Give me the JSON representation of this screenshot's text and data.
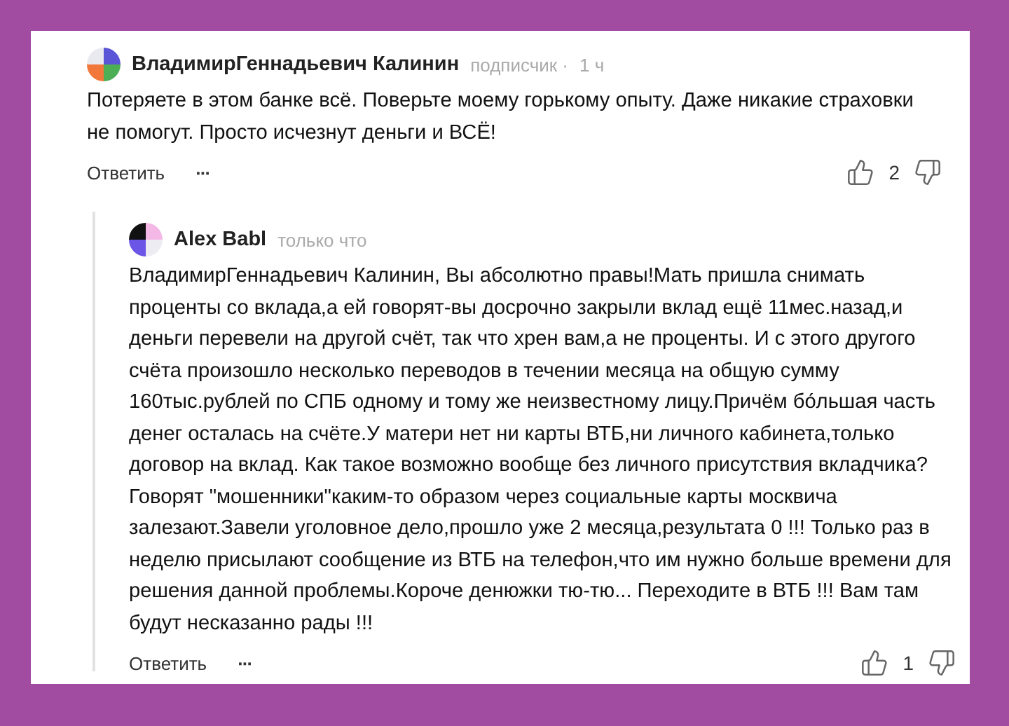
{
  "comments": [
    {
      "author": "ВладимирГеннадьевич Калинин",
      "badge": "подписчик ·",
      "time": "1 ч",
      "text": "Потеряете в этом банке всё. Поверьте моему горькому опыту. Даже никакие страховки не помогут. Просто исчезнут деньги и ВСЁ!",
      "reply_label": "Ответить",
      "more": "···",
      "likes": "2",
      "replies": [
        {
          "author": "Alex Babl",
          "time": "только что",
          "text": "ВладимирГеннадьевич Калинин, Вы абсолютно правы!Мать пришла снимать проценты со вклада,а ей говорят-вы досрочно закрыли вклад ещё 11мес.назад,и деньги перевели на другой счёт, так что хрен вам,а не проценты. И с этого другого счёта произошло несколько переводов в течении месяца на общую сумму 160тыс.рублей по СПБ одному и тому же неизвестному лицу.Причём бо́льшая часть денег осталась на счёте.У матери нет ни карты ВТБ,ни личного кабинета,только договор на вклад. Как такое возможно вообще без личного присутствия вкладчика? Говорят \"мошенники\"каким-то образом через социальные карты москвича залезают.Завели уголовное дело,прошло уже 2 месяца,результата 0 !!! Только раз в неделю присылают сообщение из ВТБ на телефон,что им нужно больше времени для решения данной проблемы.Короче денюжки тю-тю... Переходите в ВТБ !!! Вам там будут несказанно рады !!!",
          "reply_label": "Ответить",
          "more": "···",
          "likes": "1"
        }
      ]
    }
  ]
}
